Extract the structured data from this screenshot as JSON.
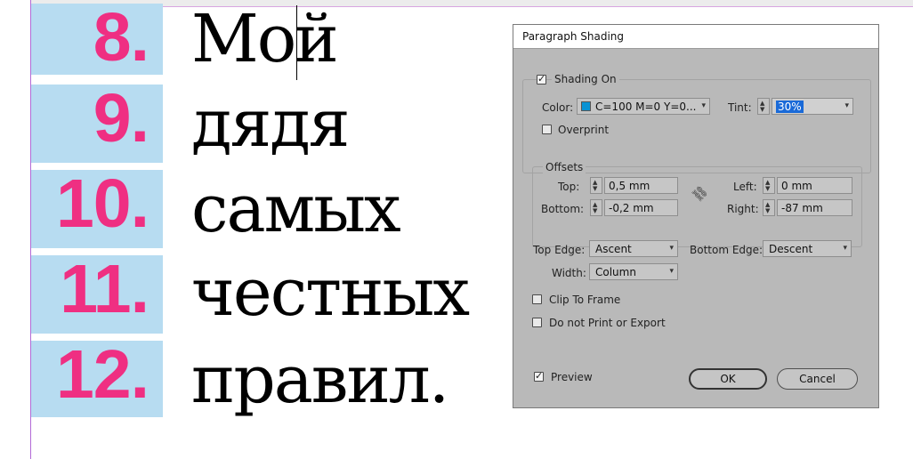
{
  "canvas": {
    "rows": [
      {
        "num": "8.",
        "word": "Мой"
      },
      {
        "num": "9.",
        "word": "дядя"
      },
      {
        "num": "10.",
        "word": "самых"
      },
      {
        "num": "11.",
        "word": "честных"
      },
      {
        "num": "12.",
        "word": "правил."
      }
    ],
    "colors": {
      "number": "#ef2f82",
      "shading": "#b7dcf1",
      "guide": "#b36ad6"
    }
  },
  "dialog": {
    "title": "Paragraph Shading",
    "shading_on": {
      "label": "Shading On",
      "checked": true
    },
    "color": {
      "label": "Color:",
      "value": "C=100 M=0 Y=0...",
      "swatch": "#0a93d4"
    },
    "tint": {
      "label": "Tint:",
      "value": "30%"
    },
    "overprint": {
      "label": "Overprint",
      "checked": false
    },
    "offsets": {
      "legend": "Offsets",
      "top": {
        "label": "Top:",
        "value": "0,5 mm"
      },
      "bottom": {
        "label": "Bottom:",
        "value": "-0,2 mm"
      },
      "left": {
        "label": "Left:",
        "value": "0 mm"
      },
      "right": {
        "label": "Right:",
        "value": "-87 mm"
      },
      "link_icon": "broken-link-icon"
    },
    "top_edge": {
      "label": "Top Edge:",
      "value": "Ascent"
    },
    "bottom_edge": {
      "label": "Bottom Edge:",
      "value": "Descent"
    },
    "width": {
      "label": "Width:",
      "value": "Column"
    },
    "clip_to_frame": {
      "label": "Clip To Frame",
      "checked": false
    },
    "do_not_print": {
      "label": "Do not Print or Export",
      "checked": false
    },
    "preview": {
      "label": "Preview",
      "checked": true
    },
    "ok_label": "OK",
    "cancel_label": "Cancel"
  }
}
